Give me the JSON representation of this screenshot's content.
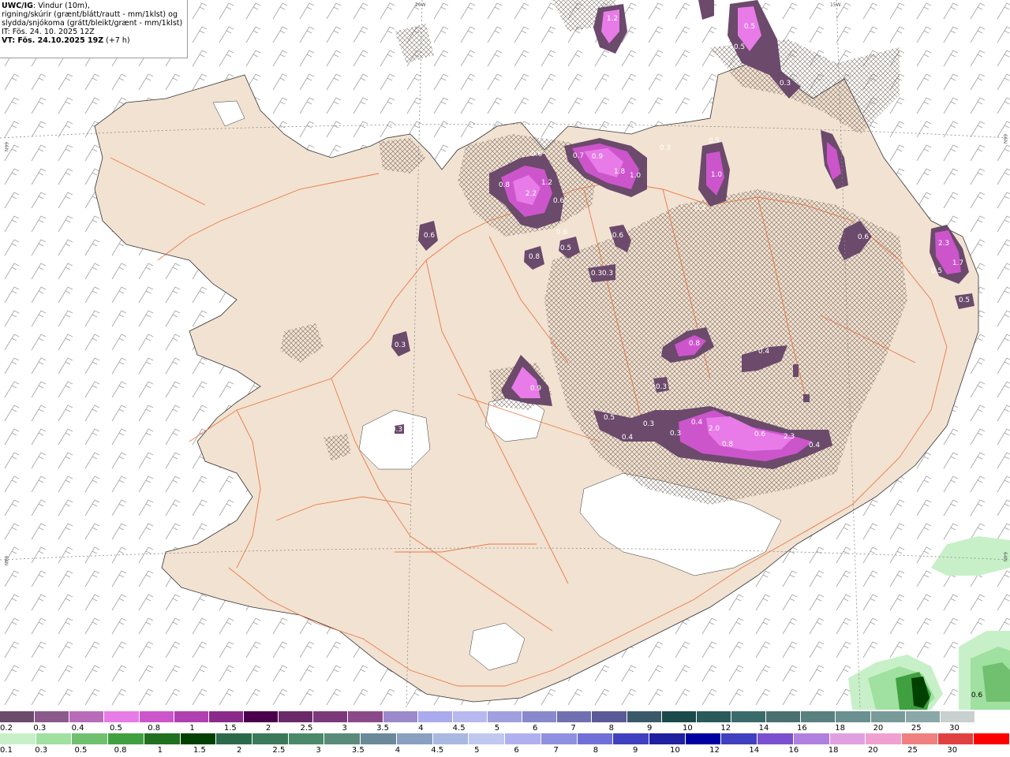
{
  "header": {
    "model": "UWC/IG",
    "line1": ": Vindur (10m),",
    "line2": "rigning/skúrir (grænt/blátt/rautt - mm/1klst) og",
    "line3": "slydda/snjókoma (grátt/bleikt/grænt - mm/1klst)",
    "init": "IT: Fös. 24. 10. 2025 12Z",
    "valid_prefix": "VT: Fös. 24.10.2025 19Z",
    "valid_suffix": " (+7 h)"
  },
  "coords": {
    "lon1": "20W",
    "lon2": "15W",
    "lat1": "66N",
    "lat2": "64N"
  },
  "snow_labels": [
    "1.2",
    "0.5",
    "0.5",
    "0.3",
    "0.6",
    "0.7",
    "0.9",
    "1.8",
    "1.0",
    "0.3",
    "0.5",
    "1.0",
    "0.8",
    "1.2",
    "2.2",
    "0.6",
    "0.6",
    "0.6",
    "0.5",
    "0.6",
    "0.8",
    "0.6",
    "2.3",
    "1.7",
    "0.5",
    "0.5",
    "0.3",
    "0.3",
    "0.8",
    "0.4",
    "0.9",
    "0.3",
    "0.3",
    "0.5",
    "0.4",
    "0.3",
    "0.3",
    "0.4",
    "2.0",
    "0.8",
    "0.6",
    "2.3",
    "0.4",
    "0.3",
    "0.3"
  ],
  "rain_labels": [
    "0.6"
  ],
  "legend_snow": {
    "colors": [
      "#6b4a6b",
      "#8a5a8a",
      "#b86bb8",
      "#e87be8",
      "#cc55cc",
      "#b040b0",
      "#8a2a8a",
      "#4a004a",
      "#6a2a6a",
      "#7a3a7a",
      "#8a4a8a",
      "#9a8acc",
      "#aaaaee",
      "#b8b8f0",
      "#a0a0e0",
      "#8888cc",
      "#7070b0",
      "#5a5a98",
      "#3a5a6a",
      "#1a4a4a",
      "#2a5a5a",
      "#3a6a6a",
      "#4a7070",
      "#5a8080",
      "#6a9090",
      "#7a9a9a",
      "#8aa8a8",
      "#c8d0d0",
      "#ffffff"
    ],
    "ticks": [
      "0.2",
      "0.3",
      "0.4",
      "0.5",
      "0.8",
      "1",
      "1.5",
      "2",
      "2.5",
      "3",
      "3.5",
      "4",
      "4.5",
      "5",
      "6",
      "7",
      "8",
      "9",
      "10",
      "12",
      "14",
      "16",
      "18",
      "20",
      "25",
      "30"
    ]
  },
  "legend_rain": {
    "colors": [
      "#c8f0c8",
      "#a0e0a0",
      "#70c070",
      "#40a040",
      "#207020",
      "#004000",
      "#2a6a4a",
      "#3a7a5a",
      "#4a8a6a",
      "#5a8a7a",
      "#6a8a9a",
      "#8aa0c0",
      "#a8b8e0",
      "#c0c8f0",
      "#b0b0f0",
      "#9090e0",
      "#7070d8",
      "#4040c0",
      "#2020a0",
      "#0000a0",
      "#4040c0",
      "#7a50d0",
      "#b080e0",
      "#e0a0e0",
      "#f0a0d0",
      "#f08080",
      "#e04040",
      "#ff0000"
    ],
    "ticks": [
      "0.1",
      "0.3",
      "0.5",
      "0.8",
      "1",
      "1.5",
      "2",
      "2.5",
      "3",
      "3.5",
      "4",
      "4.5",
      "5",
      "6",
      "7",
      "8",
      "9",
      "10",
      "12",
      "14",
      "16",
      "18",
      "20",
      "25",
      "30"
    ]
  }
}
